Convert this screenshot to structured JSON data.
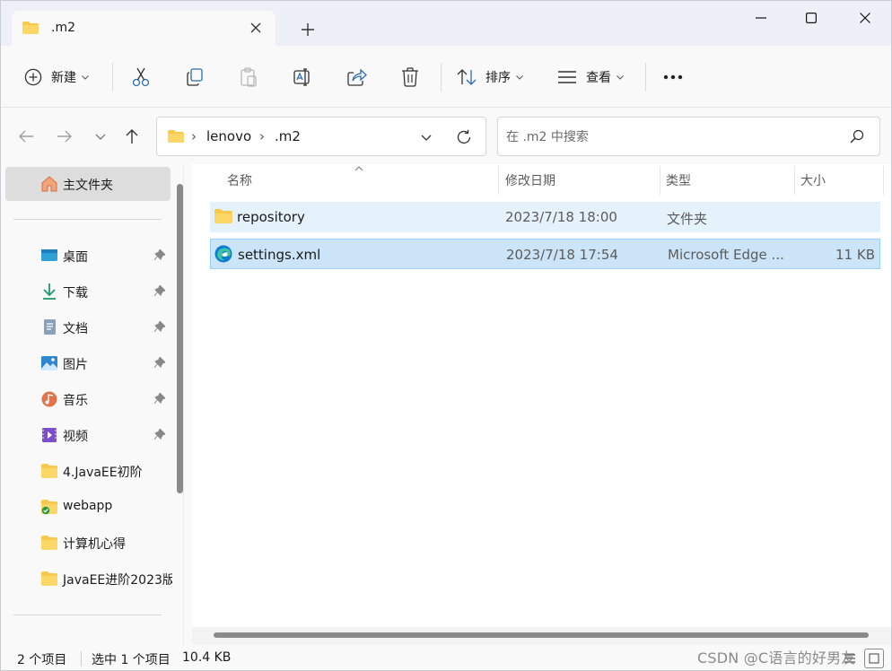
{
  "tab": {
    "title": ".m2",
    "close_icon": "close-icon",
    "new_tab_icon": "plus-icon"
  },
  "window_controls": {
    "minimize": "minimize-icon",
    "maximize": "maximize-icon",
    "close": "close-icon"
  },
  "toolbar": {
    "new_label": "新建",
    "sort_label": "排序",
    "view_label": "查看",
    "icons": [
      "cut-icon",
      "copy-icon",
      "paste-icon",
      "rename-icon",
      "share-icon",
      "delete-icon",
      "more-icon"
    ]
  },
  "address": {
    "crumbs": [
      "lenovo",
      ".m2"
    ],
    "separator": "›"
  },
  "search": {
    "placeholder": "在 .m2 中搜索"
  },
  "sidebar": {
    "home_label": "主文件夹",
    "items": [
      {
        "label": "桌面",
        "icon": "desktop-icon",
        "pinned": true
      },
      {
        "label": "下载",
        "icon": "download-icon",
        "pinned": true
      },
      {
        "label": "文档",
        "icon": "documents-icon",
        "pinned": true
      },
      {
        "label": "图片",
        "icon": "pictures-icon",
        "pinned": true
      },
      {
        "label": "音乐",
        "icon": "music-icon",
        "pinned": true
      },
      {
        "label": "视频",
        "icon": "videos-icon",
        "pinned": true
      },
      {
        "label": "4.JavaEE初阶",
        "icon": "folder-icon",
        "pinned": false
      },
      {
        "label": "webapp",
        "icon": "folder-synced-icon",
        "pinned": false
      },
      {
        "label": "计算机心得",
        "icon": "folder-icon",
        "pinned": false
      },
      {
        "label": "JavaEE进阶2023版",
        "icon": "folder-icon",
        "pinned": false
      }
    ]
  },
  "columns": {
    "name": "名称",
    "date": "修改日期",
    "type": "类型",
    "size": "大小"
  },
  "files": [
    {
      "name": "repository",
      "date": "2023/7/18 18:00",
      "type": "文件夹",
      "size": "",
      "icon": "folder-icon"
    },
    {
      "name": "settings.xml",
      "date": "2023/7/18 17:54",
      "type": "Microsoft Edge ...",
      "size": "11 KB",
      "icon": "edge-icon"
    }
  ],
  "status": {
    "item_count": "2 个项目",
    "selection": "选中 1 个项目",
    "selection_size": "10.4 KB"
  },
  "watermark": "CSDN @C语言的好男友",
  "colors": {
    "selected_row": "#cce4f7",
    "hover_row": "#e5f1fb",
    "folder": "#f8c94a",
    "accent": "#0067c0"
  }
}
